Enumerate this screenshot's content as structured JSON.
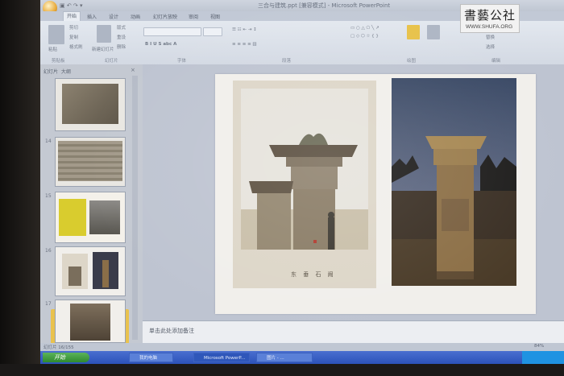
{
  "window": {
    "title": "三合与建筑.ppt [兼容模式] - Microsoft PowerPoint"
  },
  "ribbon": {
    "tabs": [
      "开始",
      "插入",
      "设计",
      "动画",
      "幻灯片放映",
      "审阅",
      "视图"
    ],
    "active_tab": "开始",
    "groups": [
      "剪贴板",
      "幻灯片",
      "字体",
      "段落",
      "绘图",
      "编辑"
    ],
    "clipboard": {
      "paste": "粘贴",
      "cut": "剪切",
      "copy": "复制",
      "format_painter": "格式刷"
    },
    "slides": {
      "new_slide": "新建幻灯片",
      "layout": "版式",
      "reset": "重设",
      "delete": "删除"
    },
    "editing": {
      "find": "查找",
      "replace": "替换",
      "select": "选择"
    }
  },
  "watermark": {
    "text_cn": "書藝公社",
    "url": "WWW.SHUFA.ORG"
  },
  "slide_panel": {
    "tabs": [
      "幻灯片",
      "大纲"
    ],
    "close_icon": "×",
    "slides": [
      {
        "num": "",
        "kind": "stone-rubbing"
      },
      {
        "num": "14",
        "kind": "stone-relief"
      },
      {
        "num": "15",
        "kind": "text-and-photo"
      },
      {
        "num": "16",
        "kind": "two-photos",
        "selected": true
      },
      {
        "num": "17",
        "kind": "photo"
      }
    ]
  },
  "slide": {
    "caption": "东 垂 石 阙",
    "left_image": "stone-que-tower-photo-icon",
    "right_image": "stone-column-photo-icon"
  },
  "notes": {
    "placeholder": "单击此处添加备注"
  },
  "status": {
    "left": "幻灯片 16/155",
    "zoom": "84%"
  },
  "taskbar": {
    "start": "开始",
    "items": [
      {
        "label": "我的电脑",
        "active": false
      },
      {
        "label": "Microsoft PowerP...",
        "active": true
      },
      {
        "label": "图片 - ...",
        "active": false
      }
    ]
  },
  "colors": {
    "taskbar": "#2b52b9",
    "start": "#2f8a2e",
    "selected_thumb": "#e9c24e",
    "slide_bg": "#f1efeb"
  }
}
